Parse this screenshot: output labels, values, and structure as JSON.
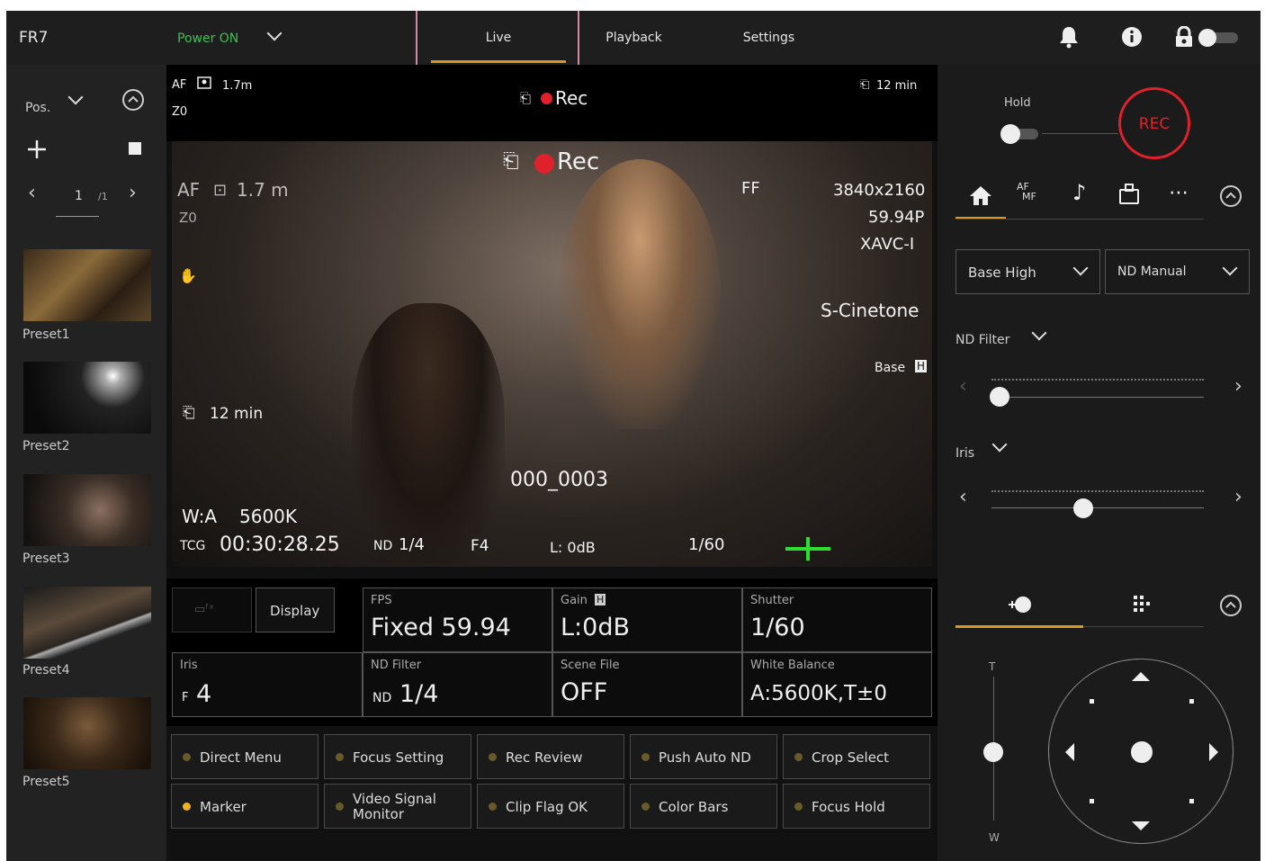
{
  "header": {
    "model": "FR7",
    "power": "Power ON",
    "tabs": [
      "Live",
      "Playback",
      "Settings"
    ]
  },
  "left": {
    "pos_label": "Pos.",
    "page_current": "1",
    "page_total": "/1",
    "presets": [
      "Preset1",
      "Preset2",
      "Preset3",
      "Preset4",
      "Preset5"
    ]
  },
  "status_top": {
    "af": "AF",
    "focus_dist": "1.7m",
    "zoom": "Z0",
    "rec": "Rec",
    "remaining": "12 min"
  },
  "video": {
    "af": "AF",
    "focus_dist": "1.7 m",
    "zoom": "Z0",
    "rec": "Rec",
    "ff": "FF",
    "resolution": "3840x2160",
    "framerate": "59.94P",
    "codec": "XAVC-I",
    "look": "S-Cinetone",
    "base": "Base",
    "base_badge": "H",
    "remaining": "12 min",
    "clip": "000_0003",
    "wb": "W:A",
    "wb_val": "5600K",
    "tcg": "TCG",
    "timecode": "00:30:28.25",
    "nd": "ND",
    "nd_val": "1/4",
    "iris": "F4",
    "gain": "L: 0dB",
    "shutter": "1/60"
  },
  "grid": {
    "display_btn": "Display",
    "fps_label": "FPS",
    "fps_value": "Fixed 59.94",
    "gain_label": "Gain",
    "gain_badge": "H",
    "gain_value": "L:0dB",
    "shutter_label": "Shutter",
    "shutter_value": "1/60",
    "iris_label": "Iris",
    "iris_prefix": "F",
    "iris_value": "4",
    "nd_label": "ND Filter",
    "nd_prefix": "ND",
    "nd_value": "1/4",
    "scene_label": "Scene File",
    "scene_value": "OFF",
    "wb_label": "White Balance",
    "wb_value": "A:5600K,T±0"
  },
  "assign": [
    "Direct Menu",
    "Focus Setting",
    "Rec Review",
    "Push Auto ND",
    "Crop Select",
    "Marker",
    "Video Signal Monitor",
    "Clip Flag OK",
    "Color Bars",
    "Focus Hold"
  ],
  "right": {
    "hold": "Hold",
    "rec": "REC",
    "afmf_a": "AF",
    "afmf_b": "MF",
    "base_select": "Base High",
    "nd_select": "ND Manual",
    "nd_filter": "ND Filter",
    "iris": "Iris",
    "zoom_t": "T",
    "zoom_w": "W"
  },
  "colors": {
    "accent": "#d89a1c",
    "power": "#3fbf55",
    "rec": "#e0202a"
  }
}
